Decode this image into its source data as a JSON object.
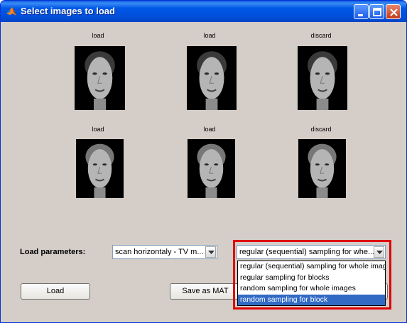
{
  "window": {
    "title": "Select images to load"
  },
  "faces": [
    {
      "label": "load"
    },
    {
      "label": "load"
    },
    {
      "label": "discard"
    },
    {
      "label": "load"
    },
    {
      "label": "load"
    },
    {
      "label": "discard"
    }
  ],
  "params": {
    "label": "Load parameters:",
    "scan_value": "scan horizontaly - TV m...",
    "sampling_value": "regular (sequential) sampling for whe...",
    "sampling_options": [
      "regular (sequential) sampling for whole images",
      "regular sampling for blocks",
      "random sampling for whole images",
      "random sampling for block"
    ],
    "selected_index": 3
  },
  "buttons": {
    "load": "Load",
    "save_as_mat": "Save as MAT"
  }
}
